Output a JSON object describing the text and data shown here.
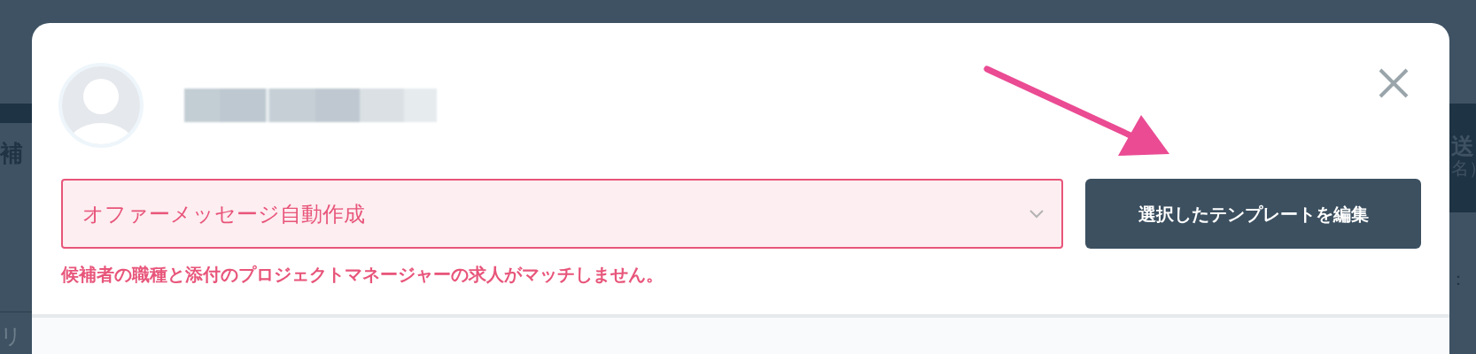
{
  "background_page": {
    "left_fragments": [
      "補",
      "リ"
    ],
    "right_fragments": [
      "送",
      "名）"
    ],
    "count_label": "："
  },
  "modal": {
    "template_select": {
      "value": "オファーメッセージ自動作成",
      "error": true
    },
    "error_message": "候補者の職種と添付のプロジェクトマネージャーの求人がマッチしません。",
    "edit_button": "選択したテンプレートを編集"
  }
}
